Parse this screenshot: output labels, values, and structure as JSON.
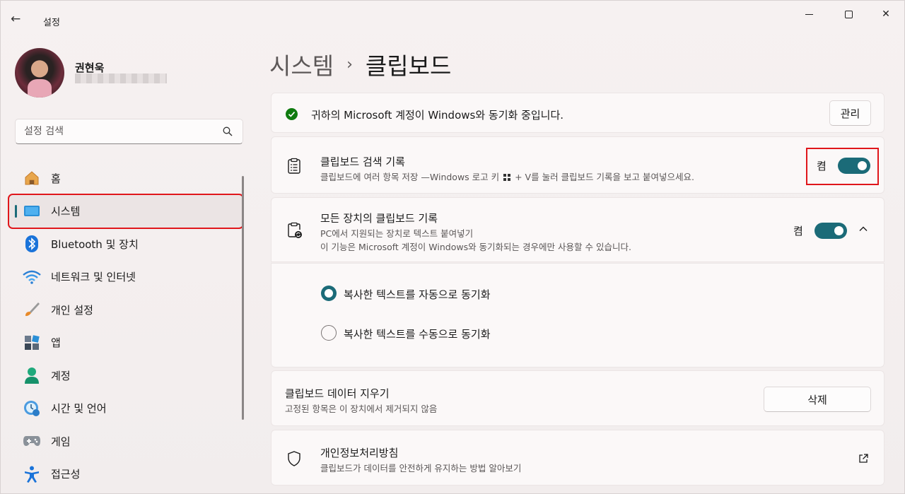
{
  "window": {
    "app_title": "설정",
    "back_glyph": "←",
    "close_glyph": "✕"
  },
  "user": {
    "name": "권현욱"
  },
  "search": {
    "placeholder": "설정 검색"
  },
  "sidebar": {
    "items": [
      {
        "label": "홈",
        "icon": "home-icon"
      },
      {
        "label": "시스템",
        "icon": "system-icon",
        "selected": true
      },
      {
        "label": "Bluetooth 및 장치",
        "icon": "bluetooth-icon"
      },
      {
        "label": "네트워크 및 인터넷",
        "icon": "wifi-icon"
      },
      {
        "label": "개인 설정",
        "icon": "brush-icon"
      },
      {
        "label": "앱",
        "icon": "apps-icon"
      },
      {
        "label": "계정",
        "icon": "account-icon"
      },
      {
        "label": "시간 및 언어",
        "icon": "time-language-icon"
      },
      {
        "label": "게임",
        "icon": "gamepad-icon"
      },
      {
        "label": "접근성",
        "icon": "accessibility-icon"
      }
    ]
  },
  "breadcrumb": {
    "parent": "시스템",
    "separator": "›",
    "current": "클립보드"
  },
  "sync_banner": {
    "text": "귀하의 Microsoft 계정이 Windows와 동기화 중입니다.",
    "button": "관리"
  },
  "clipboard_history": {
    "title": "클립보드 검색 기록",
    "desc_before": "클립보드에 여러 항목 저장 —Windows 로고 키",
    "desc_after": "+ V를 눌러 클립보드 기록을 보고 붙여넣으세요.",
    "state": "켬",
    "on": true
  },
  "cross_device": {
    "title": "모든 장치의 클립보드 기록",
    "desc1": "PC에서 지원되는 장치로 텍스트 붙여넣기",
    "desc2": "이 기능은 Microsoft 계정이 Windows와 동기화되는 경우에만 사용할 수 있습니다.",
    "state": "켬",
    "on": true,
    "options": [
      {
        "label": "복사한 텍스트를 자동으로 동기화",
        "selected": true
      },
      {
        "label": "복사한 텍스트를 수동으로 동기화",
        "selected": false
      }
    ]
  },
  "clear_data": {
    "title": "클립보드 데이터 지우기",
    "desc": "고정된 항목은 이 장치에서 제거되지 않음",
    "button": "삭제"
  },
  "privacy": {
    "title": "개인정보처리방침",
    "desc": "클립보드가 데이터를 안전하게 유지하는 방법 알아보기"
  },
  "colors": {
    "accent": "#1b6b78",
    "highlight": "#e0161b",
    "success": "#0f7b0f"
  }
}
